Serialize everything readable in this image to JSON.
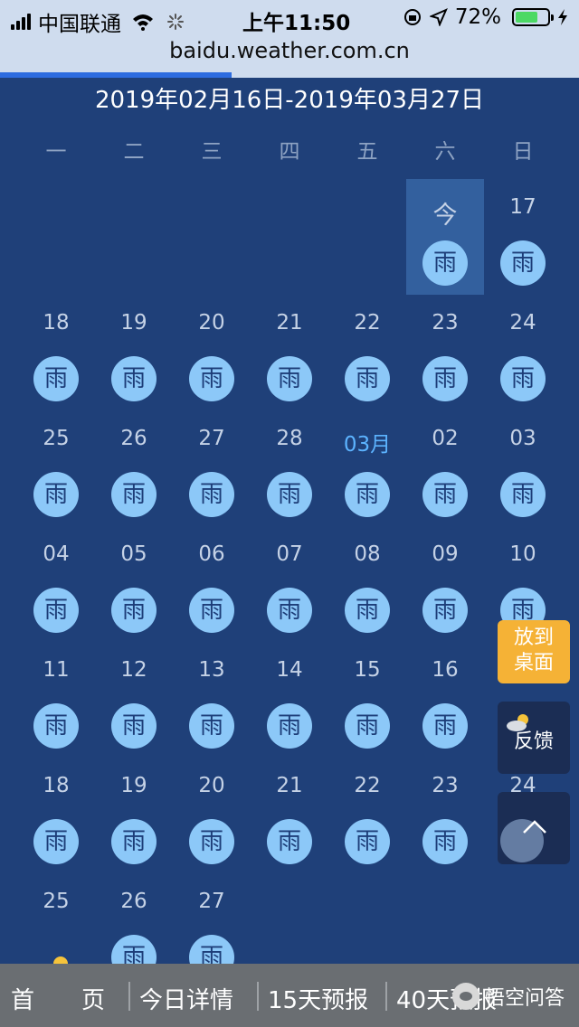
{
  "status_bar": {
    "carrier": "中国联通",
    "time": "上午11:50",
    "battery_percent": "72%",
    "battery_level": 0.72
  },
  "url_bar": {
    "url": "baidu.weather.com.cn",
    "load_progress": 0.4
  },
  "calendar": {
    "range_title": "2019年02月16日-2019年03月27日",
    "weekdays": [
      "一",
      "二",
      "三",
      "四",
      "五",
      "六",
      "日"
    ],
    "weather_label": "雨",
    "rows": [
      [
        null,
        null,
        null,
        null,
        null,
        {
          "day": "今",
          "today": true
        },
        {
          "day": "17"
        }
      ],
      [
        {
          "day": "18"
        },
        {
          "day": "19"
        },
        {
          "day": "20"
        },
        {
          "day": "21"
        },
        {
          "day": "22"
        },
        {
          "day": "23"
        },
        {
          "day": "24"
        }
      ],
      [
        {
          "day": "25"
        },
        {
          "day": "26"
        },
        {
          "day": "27"
        },
        {
          "day": "28"
        },
        {
          "day": "03月",
          "month": true
        },
        {
          "day": "02"
        },
        {
          "day": "03"
        }
      ],
      [
        {
          "day": "04"
        },
        {
          "day": "05"
        },
        {
          "day": "06"
        },
        {
          "day": "07"
        },
        {
          "day": "08"
        },
        {
          "day": "09"
        },
        {
          "day": "10"
        }
      ],
      [
        {
          "day": "11"
        },
        {
          "day": "12"
        },
        {
          "day": "13"
        },
        {
          "day": "14"
        },
        {
          "day": "15"
        },
        {
          "day": "16"
        },
        null
      ],
      [
        {
          "day": "18"
        },
        {
          "day": "19"
        },
        {
          "day": "20"
        },
        {
          "day": "21"
        },
        {
          "day": "22"
        },
        {
          "day": "23"
        },
        {
          "day": "24"
        }
      ],
      [
        {
          "day": "25",
          "icon": "cloud-sun"
        },
        {
          "day": "26"
        },
        {
          "day": "27"
        },
        null,
        null,
        null,
        null
      ]
    ]
  },
  "floating": {
    "pin_to_desktop": "放到桌面",
    "feedback": "反馈"
  },
  "bottom_nav": {
    "items": [
      "首　　页",
      "今日详情",
      "15天预报",
      "40天预报"
    ]
  },
  "watermark": "悟空问答",
  "colors": {
    "background": "#1f4079",
    "rain_badge": "#8cc8f8",
    "today_highlight": "#33609e",
    "pin_button": "#f5b236",
    "nav_bar": "#6a6e72"
  }
}
